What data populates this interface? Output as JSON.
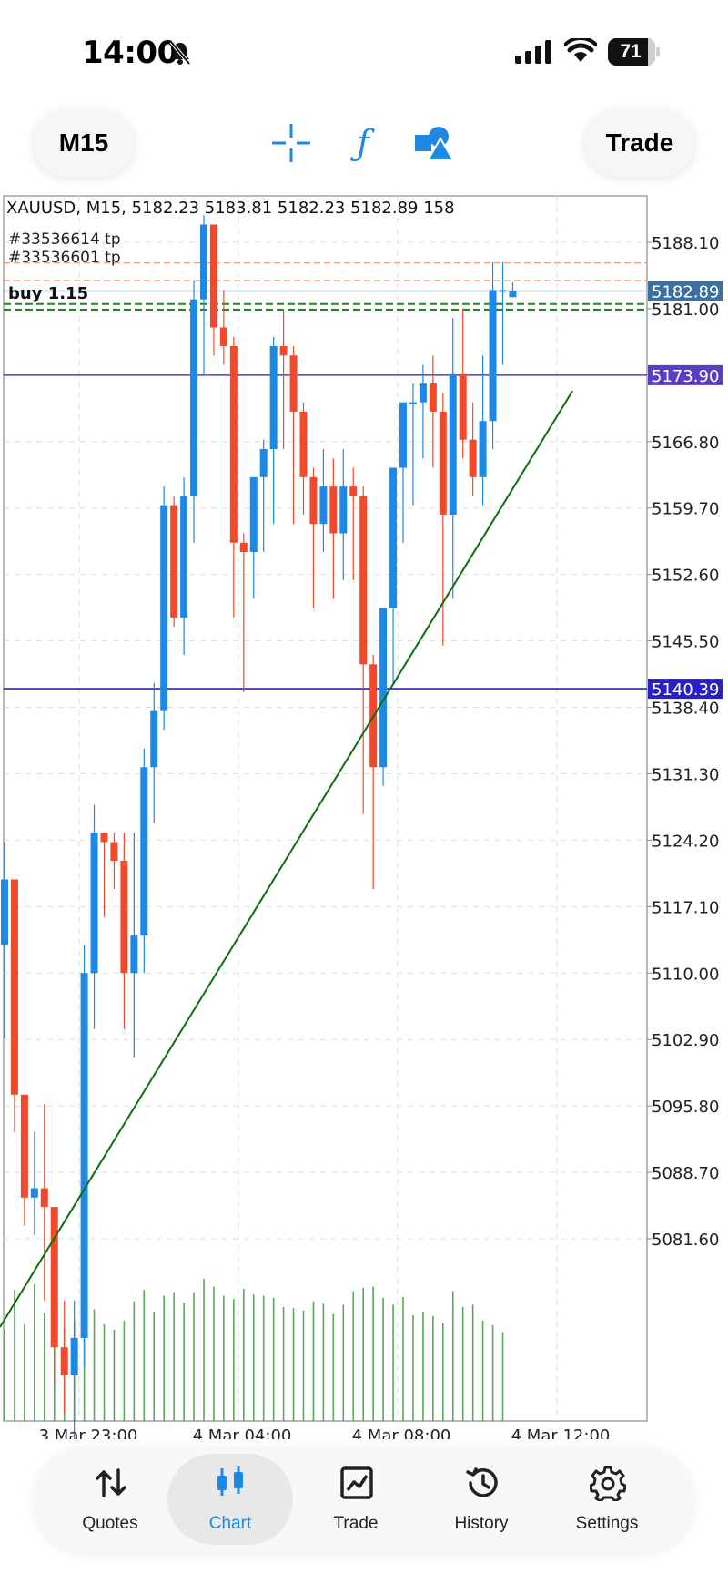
{
  "status": {
    "time": "14:00",
    "battery": "71"
  },
  "toolbar": {
    "timeframe": "M15",
    "trade_label": "Trade",
    "icons": [
      "crosshair-icon",
      "indicator-f-icon",
      "shapes-icon"
    ]
  },
  "chart": {
    "header": "XAUUSD, M15, 5182.23 5183.81 5182.23 5182.89 158",
    "order_labels": [
      "#33536614 tp",
      "#33536601 tp"
    ],
    "buy_label": "buy 1.15",
    "price_ticks": [
      "5188.10",
      "5181.00",
      "5166.80",
      "5159.70",
      "5152.60",
      "5145.50",
      "5138.40",
      "5131.30",
      "5124.20",
      "5117.10",
      "5110.00",
      "5102.90",
      "5095.80",
      "5088.70",
      "5081.60"
    ],
    "price_tick_values": [
      5188.1,
      5181.0,
      5166.8,
      5159.7,
      5152.6,
      5145.5,
      5138.4,
      5131.3,
      5124.2,
      5117.1,
      5110.0,
      5102.9,
      5095.8,
      5088.7,
      5081.6
    ],
    "current_price_label": "5182.89",
    "current_price": 5182.89,
    "hlines": [
      {
        "label": "5173.90",
        "price": 5173.9,
        "color": "#5b3cc4"
      },
      {
        "label": "5140.39",
        "price": 5140.39,
        "color": "#2a1fc2"
      }
    ],
    "tp_lines": [
      5185.9,
      5184.0
    ],
    "buy_lines": [
      5181.5,
      5180.9
    ],
    "time_labels": [
      "3 Mar 23:00",
      "4 Mar 04:00",
      "4 Mar 08:00",
      "4 Mar 12:00"
    ],
    "colors": {
      "up": "#1e88e5",
      "down": "#f0492c",
      "trend": "#0b6e0b",
      "volume": "#58a858",
      "current": "#3d6fa0"
    }
  },
  "chart_data": {
    "type": "candlestick",
    "symbol": "XAUUSD",
    "timeframe": "M15",
    "ohlc": [
      [
        5113,
        5124,
        5103,
        5120
      ],
      [
        5120,
        5120,
        5093,
        5097
      ],
      [
        5097,
        5097,
        5083,
        5086
      ],
      [
        5086,
        5093,
        5082,
        5087
      ],
      [
        5087,
        5096,
        5075,
        5085
      ],
      [
        5085,
        5082,
        5066,
        5070
      ],
      [
        5070,
        5075,
        5063,
        5067
      ],
      [
        5067,
        5075,
        5060,
        5071
      ],
      [
        5071,
        5113,
        5068,
        5110
      ],
      [
        5110,
        5128,
        5104,
        5125
      ],
      [
        5125,
        5125,
        5116,
        5124
      ],
      [
        5124,
        5125,
        5119,
        5122
      ],
      [
        5122,
        5125,
        5104,
        5110
      ],
      [
        5110,
        5125,
        5101,
        5114
      ],
      [
        5114,
        5134,
        5110,
        5132
      ],
      [
        5132,
        5141,
        5126,
        5138
      ],
      [
        5138,
        5162,
        5136,
        5160
      ],
      [
        5160,
        5161,
        5147,
        5148
      ],
      [
        5148,
        5163,
        5144,
        5161
      ],
      [
        5161,
        5184,
        5156,
        5182
      ],
      [
        5182,
        5191,
        5174,
        5190
      ],
      [
        5190,
        5190,
        5176,
        5179
      ],
      [
        5179,
        5183,
        5175,
        5177
      ],
      [
        5177,
        5178,
        5148,
        5156
      ],
      [
        5156,
        5157,
        5140,
        5155
      ],
      [
        5155,
        5163,
        5150,
        5163
      ],
      [
        5163,
        5167,
        5155,
        5166
      ],
      [
        5166,
        5178,
        5158,
        5177
      ],
      [
        5177,
        5181,
        5166,
        5176
      ],
      [
        5176,
        5177,
        5158,
        5170
      ],
      [
        5170,
        5171,
        5159,
        5163
      ],
      [
        5163,
        5164,
        5149,
        5158
      ],
      [
        5158,
        5166,
        5155,
        5162
      ],
      [
        5162,
        5165,
        5150,
        5157
      ],
      [
        5157,
        5166,
        5152,
        5162
      ],
      [
        5162,
        5164,
        5152,
        5161
      ],
      [
        5161,
        5162,
        5127,
        5143
      ],
      [
        5143,
        5144,
        5119,
        5132
      ],
      [
        5132,
        5148,
        5130,
        5149
      ],
      [
        5149,
        5160,
        5141,
        5164
      ],
      [
        5164,
        5169,
        5156,
        5171
      ],
      [
        5171,
        5173,
        5160,
        5171
      ],
      [
        5171,
        5175,
        5165,
        5173
      ],
      [
        5173,
        5176,
        5164,
        5170
      ],
      [
        5170,
        5172,
        5145,
        5159
      ],
      [
        5159,
        5180,
        5150,
        5174
      ],
      [
        5174,
        5181,
        5165,
        5167
      ],
      [
        5167,
        5171,
        5161,
        5163
      ],
      [
        5163,
        5176,
        5160,
        5169
      ],
      [
        5169,
        5186,
        5166,
        5183
      ],
      [
        5183,
        5186,
        5175,
        5183
      ],
      [
        5182.23,
        5183.81,
        5182.23,
        5182.89
      ]
    ],
    "volume": [
      80,
      115,
      85,
      120,
      95,
      75,
      82,
      88,
      92,
      98,
      85,
      80,
      88,
      105,
      115,
      96,
      110,
      113,
      104,
      113,
      125,
      118,
      110,
      107,
      116,
      111,
      110,
      108,
      100,
      99,
      97,
      105,
      103,
      94,
      102,
      114,
      117,
      118,
      108,
      102,
      109,
      93,
      96,
      92,
      86,
      114,
      100,
      102,
      88,
      84,
      78,
      0
    ],
    "trendline": {
      "from": [
        0,
        5078
      ],
      "to": [
        57,
        5173
      ]
    },
    "ylim": [
      5076.6,
      5193.5
    ],
    "xlabels": [
      "3 Mar 23:00",
      "4 Mar 04:00",
      "4 Mar 08:00",
      "4 Mar 12:00"
    ]
  },
  "nav": [
    {
      "label": "Quotes",
      "icon": "quotes-arrows-icon",
      "active": false
    },
    {
      "label": "Chart",
      "icon": "chart-candles-icon",
      "active": true
    },
    {
      "label": "Trade",
      "icon": "trade-chart-icon",
      "active": false
    },
    {
      "label": "History",
      "icon": "history-icon",
      "active": false
    },
    {
      "label": "Settings",
      "icon": "settings-gear-icon",
      "active": false
    }
  ]
}
